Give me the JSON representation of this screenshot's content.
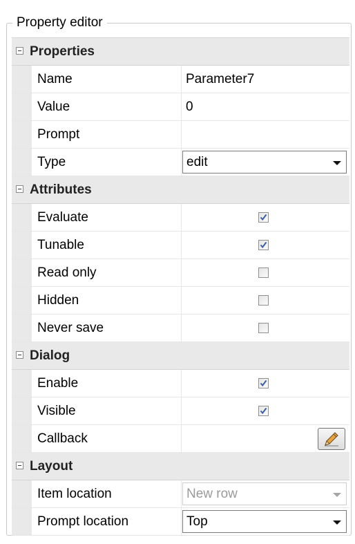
{
  "panel": {
    "title": "Property editor"
  },
  "colors": {
    "category_bg": "#e9e9e9",
    "check_color": "#3a5fa8",
    "pencil_color": "#e8a33c"
  },
  "categories": [
    {
      "label": "Properties",
      "rows": [
        {
          "name": "Name",
          "value": "Parameter7"
        },
        {
          "name": "Value",
          "value": "0"
        },
        {
          "name": "Prompt",
          "value": ""
        },
        {
          "name": "Type",
          "value": "edit",
          "control": "combo"
        }
      ]
    },
    {
      "label": "Attributes",
      "rows": [
        {
          "name": "Evaluate",
          "checked": true
        },
        {
          "name": "Tunable",
          "checked": true
        },
        {
          "name": "Read only",
          "checked": false
        },
        {
          "name": "Hidden",
          "checked": false
        },
        {
          "name": "Never save",
          "checked": false
        }
      ]
    },
    {
      "label": "Dialog",
      "rows": [
        {
          "name": "Enable",
          "checked": true
        },
        {
          "name": "Visible",
          "checked": true
        },
        {
          "name": "Callback",
          "control": "edit-button",
          "icon": "pencil-icon"
        }
      ]
    },
    {
      "label": "Layout",
      "rows": [
        {
          "name": "Item location",
          "value": "New row",
          "control": "combo",
          "disabled": true
        },
        {
          "name": "Prompt location",
          "value": "Top",
          "control": "combo"
        }
      ]
    }
  ]
}
